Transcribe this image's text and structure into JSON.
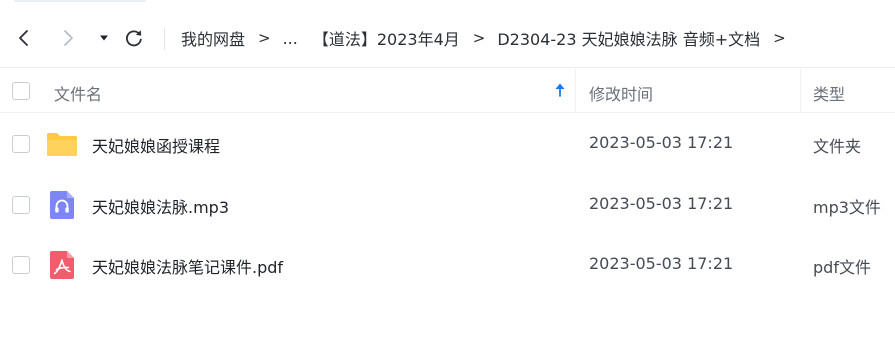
{
  "breadcrumb": {
    "root": "我的网盘",
    "ellipsis": "...",
    "folder_1": "【道法】2023年4月",
    "folder_2": "D2304-23 天妃娘娘法脉 音频+文档",
    "separator": ">"
  },
  "table": {
    "headers": {
      "name": "文件名",
      "modified": "修改时间",
      "type": "类型"
    },
    "sort": {
      "column": "name",
      "direction": "ascending"
    },
    "rows": [
      {
        "name": "天妃娘娘函授课程",
        "modified": "2023-05-03 17:21",
        "type": "文件夹",
        "icon": "folder-icon"
      },
      {
        "name": "天妃娘娘法脉.mp3",
        "modified": "2023-05-03 17:21",
        "type": "mp3文件",
        "icon": "audio-file-icon"
      },
      {
        "name": "天妃娘娘法脉笔记课件.pdf",
        "modified": "2023-05-03 17:21",
        "type": "pdf文件",
        "icon": "pdf-file-icon"
      }
    ]
  },
  "colors": {
    "folder": "#ffc940",
    "audio": "#7e86f5",
    "pdf": "#f25c6c",
    "sort_arrow": "#0d7bff"
  }
}
